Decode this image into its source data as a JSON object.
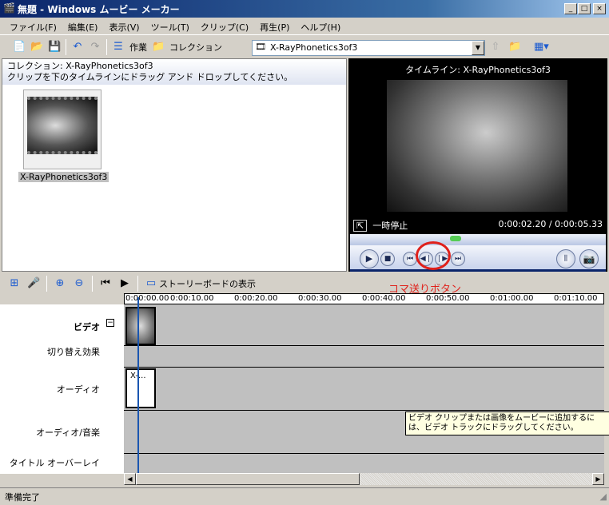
{
  "window": {
    "title": "無題 - Windows ムービー メーカー",
    "minimize": "_",
    "maximize": "□",
    "close": "×"
  },
  "menu": [
    "ファイル(F)",
    "編集(E)",
    "表示(V)",
    "ツール(T)",
    "クリップ(C)",
    "再生(P)",
    "ヘルプ(H)"
  ],
  "toolbar": {
    "tasks_label": "作業",
    "collections_label": "コレクション",
    "collection_select": "X-RayPhonetics3of3"
  },
  "collection": {
    "title": "コレクション: X-RayPhonetics3of3",
    "hint": "クリップを下のタイムラインにドラッグ アンド ドロップしてください。",
    "clips": [
      {
        "label": "X-RayPhonetics3of3"
      }
    ]
  },
  "preview": {
    "title": "タイムライン: X-RayPhonetics3of3",
    "state": "一時停止",
    "time": "0:00:02.20 / 0:00:05.33",
    "seek_fraction": 0.41
  },
  "timeline": {
    "storyboard_label": "ストーリーボードの表示",
    "annotation": "コマ送りボタン",
    "ruler": [
      "0:00:00.00",
      "0:00:10.00",
      "0:00:20.00",
      "0:00:30.00",
      "0:00:40.00",
      "0:00:50.00",
      "0:01:00.00",
      "0:01:10.00"
    ],
    "tracks": {
      "video": "ビデオ",
      "transition": "切り替え効果",
      "audio": "オーディオ",
      "audio_music": "オーディオ/音楽",
      "title_overlay": "タイトル オーバーレイ"
    },
    "audio_clip": "X-...",
    "tooltip": "ビデオ クリップまたは画像をムービーに追加するには、ビデオ トラックにドラッグしてください。"
  },
  "status": "準備完了",
  "colors": {
    "annotation": "#e0201a",
    "playhead": "#1a56b0"
  }
}
